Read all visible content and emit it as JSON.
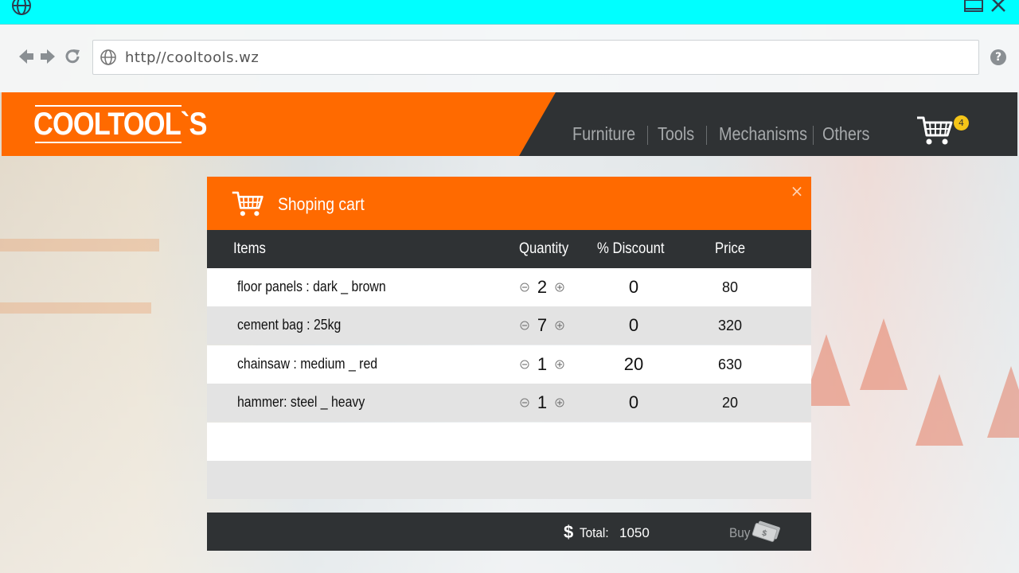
{
  "browser": {
    "url": "http//cooltools.wz",
    "help_label": "?"
  },
  "site": {
    "logo_text": "COOLTOOL`S",
    "nav": [
      {
        "label": "Furniture"
      },
      {
        "label": "Tools"
      },
      {
        "label": "Mechanisms"
      },
      {
        "label": "Others"
      }
    ],
    "cart_count": "4"
  },
  "cart": {
    "title": "Shoping cart",
    "close_label": "×",
    "columns": {
      "items": "Items",
      "quantity": "Quantity",
      "discount": "% Discount",
      "price": "Price"
    },
    "rows": [
      {
        "item": "floor panels : dark _ brown",
        "quantity": "2",
        "discount": "0",
        "price": "80"
      },
      {
        "item": "cement bag : 25kg",
        "quantity": "7",
        "discount": "0",
        "price": "320"
      },
      {
        "item": "chainsaw : medium _ red",
        "quantity": "1",
        "discount": "20",
        "price": "630"
      },
      {
        "item": "hammer: steel _ heavy",
        "quantity": "1",
        "discount": "0",
        "price": "20"
      }
    ],
    "currency_symbol": "$",
    "total_label": "Total:",
    "total_value": "1050",
    "buy_label": "Buy"
  },
  "colors": {
    "titlebar": "#00ffff",
    "brand_orange": "#ff6a00",
    "dark": "#2f3234",
    "badge": "#f5c518"
  }
}
